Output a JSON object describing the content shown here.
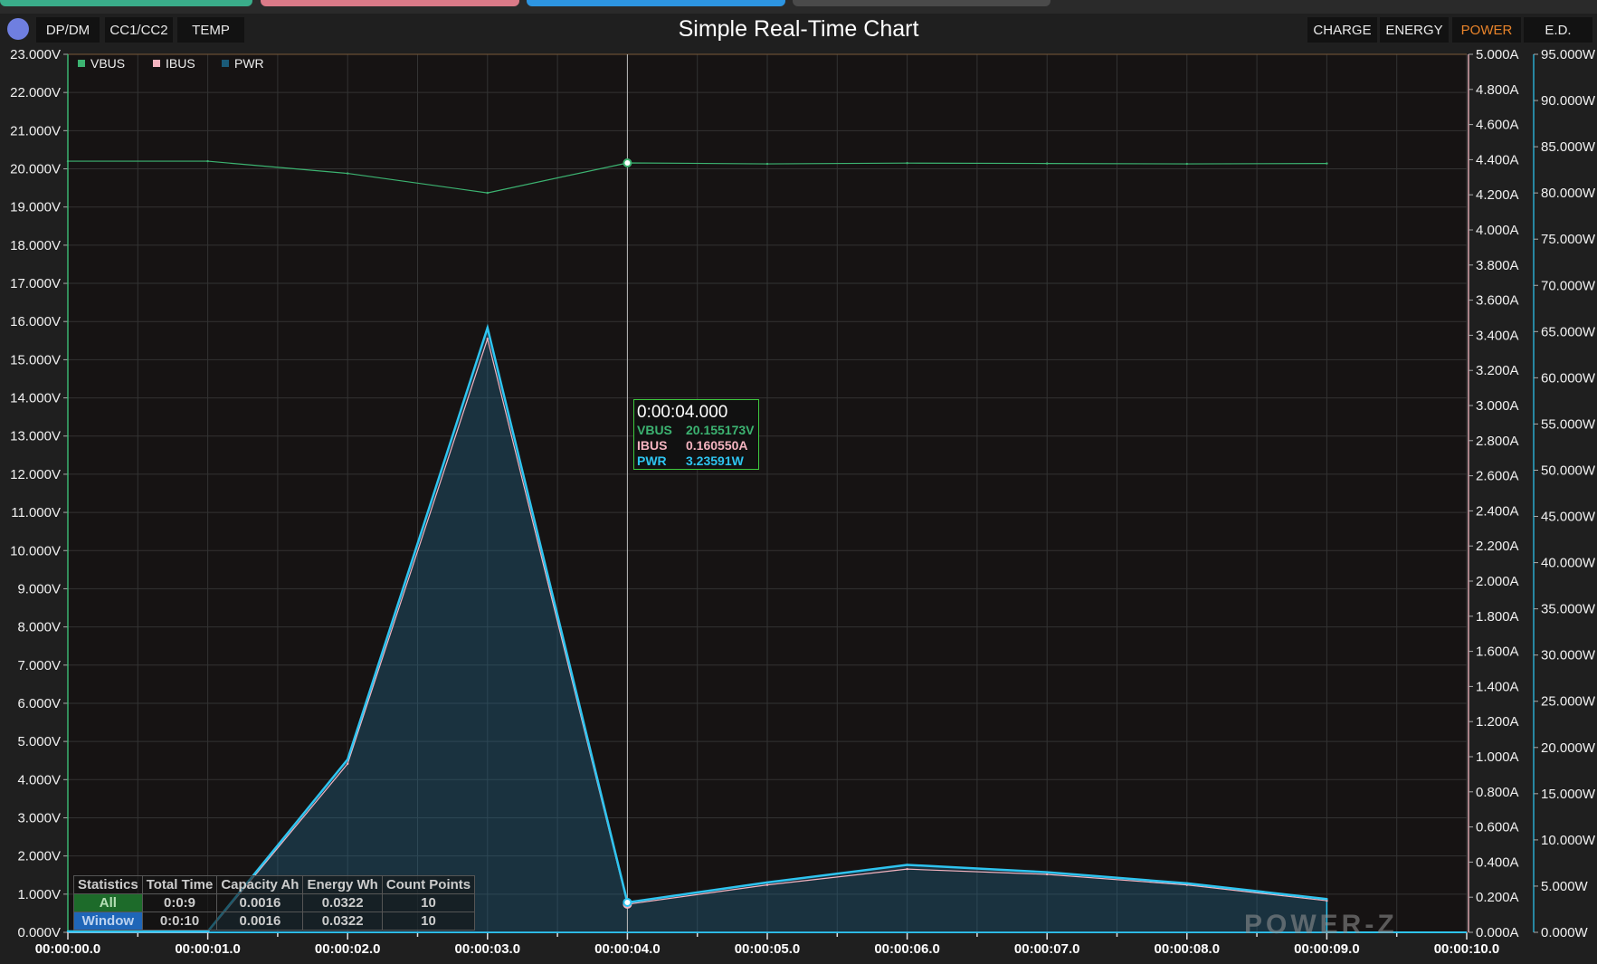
{
  "top_tabs": [
    {
      "color": "#3aad8a"
    },
    {
      "color": "#db7a88"
    },
    {
      "color": "#2d95e2"
    },
    {
      "color": "#4a4a4a"
    }
  ],
  "toolbar": {
    "left_buttons": [
      "DP/DM",
      "CC1/CC2",
      "TEMP"
    ],
    "title": "Simple Real-Time Chart",
    "right_buttons": [
      "CHARGE",
      "ENERGY",
      "POWER",
      "E.D."
    ],
    "active_right": "POWER"
  },
  "legend": [
    {
      "label": "VBUS",
      "color": "#3cb371"
    },
    {
      "label": "IBUS",
      "color": "#f4b4c0"
    },
    {
      "label": "PWR",
      "color": "#1a5a78"
    }
  ],
  "tooltip": {
    "time": "0:00:04.000",
    "rows": [
      {
        "label": "VBUS",
        "value": "20.155173V",
        "color": "#3cb371"
      },
      {
        "label": "IBUS",
        "value": "0.160550A",
        "color": "#f4b4c0"
      },
      {
        "label": "PWR",
        "value": "3.23591W",
        "color": "#2ec4f0"
      }
    ]
  },
  "stats": {
    "headers": [
      "Statistics",
      "Total Time",
      "Capacity Ah",
      "Energy Wh",
      "Count Points"
    ],
    "rows": [
      [
        "All",
        "0:0:9",
        "0.0016",
        "0.0322",
        "10"
      ],
      [
        "Window",
        "0:0:10",
        "0.0016",
        "0.0322",
        "10"
      ]
    ]
  },
  "logo": "POWER-Z",
  "chart_data": {
    "type": "line",
    "x": [
      0,
      1,
      2,
      3,
      4,
      5,
      6,
      7,
      8,
      9
    ],
    "x_tick_labels": [
      "00:00:00.0",
      "00:00:01.0",
      "00:00:02.0",
      "00:00:03.0",
      "00:00:04.0",
      "00:00:05.0",
      "00:00:06.0",
      "00:00:07.0",
      "00:00:08.0",
      "00:00:09.0",
      "00:00:10.0"
    ],
    "xlim": [
      0,
      10
    ],
    "cursor_x": 4,
    "series": [
      {
        "name": "VBUS",
        "axis": "left",
        "unit": "V",
        "color": "#3cb371",
        "values": [
          20.2,
          20.2,
          19.88,
          19.37,
          20.155,
          20.13,
          20.15,
          20.14,
          20.13,
          20.14
        ]
      },
      {
        "name": "IBUS",
        "axis": "right1",
        "unit": "A",
        "color": "#f4b4c0",
        "values": [
          0.0,
          0.0,
          0.96,
          3.38,
          0.16,
          0.27,
          0.36,
          0.33,
          0.27,
          0.18
        ]
      },
      {
        "name": "PWR",
        "axis": "right2",
        "unit": "W",
        "color": "#2ec4f0",
        "values": [
          0.1,
          0.1,
          18.7,
          65.4,
          3.236,
          5.4,
          7.3,
          6.5,
          5.3,
          3.6
        ]
      }
    ],
    "axes": {
      "left": {
        "range": [
          0,
          23
        ],
        "step": 1,
        "format": "V",
        "decimals": 3
      },
      "right1": {
        "range": [
          0,
          5
        ],
        "step": 0.2,
        "format": "A",
        "decimals": 3
      },
      "right2": {
        "range": [
          0,
          95
        ],
        "step": 5,
        "format": "W",
        "decimals": 3
      }
    },
    "grid": true,
    "legend_position": "top-left"
  }
}
